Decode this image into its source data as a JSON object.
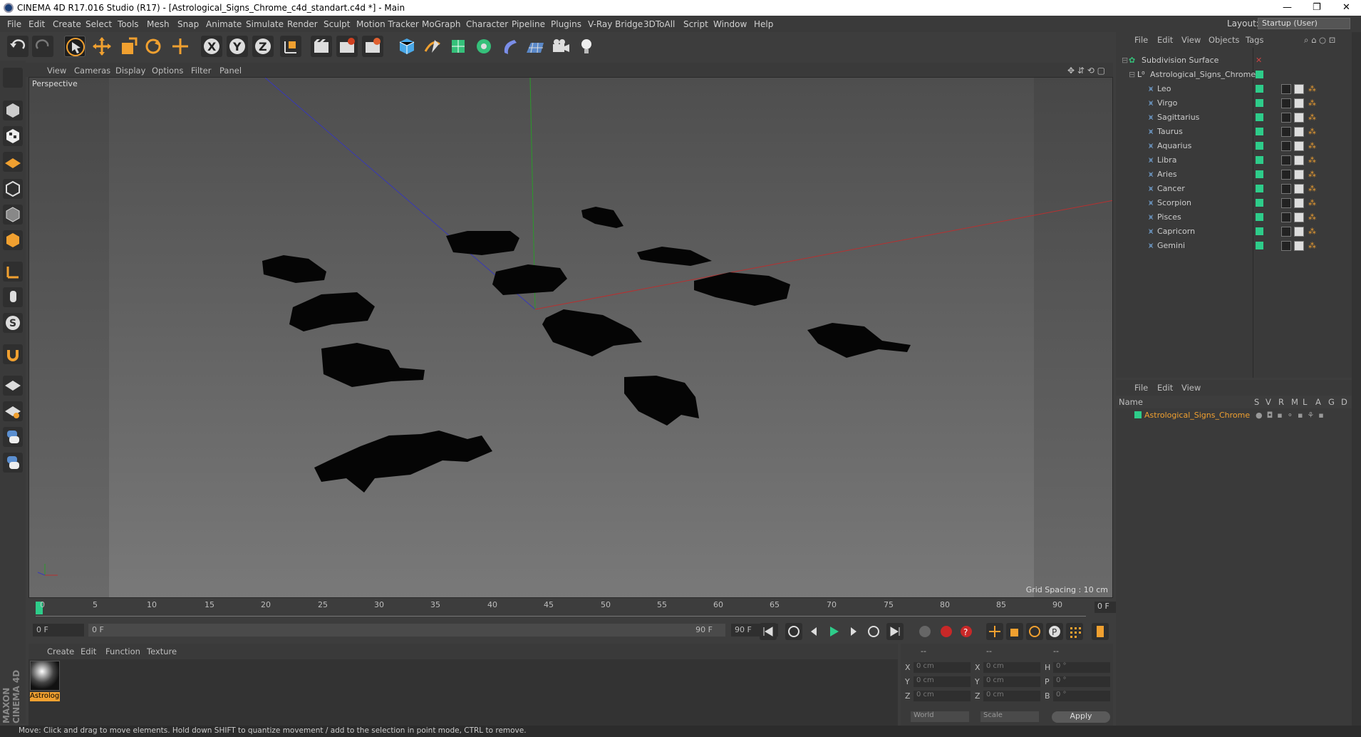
{
  "window": {
    "title": "CINEMA 4D R17.016 Studio (R17) - [Astrological_Signs_Chrome_c4d_standart.c4d *] - Main"
  },
  "menu": [
    "File",
    "Edit",
    "Create",
    "Select",
    "Tools",
    "Mesh",
    "Snap",
    "Animate",
    "Simulate",
    "Render",
    "Sculpt",
    "Motion Tracker",
    "MoGraph",
    "Character",
    "Pipeline",
    "Plugins",
    "V-Ray Bridge",
    "3DToAll",
    "Script",
    "Window",
    "Help"
  ],
  "layout": {
    "label": "Layout:",
    "value": "Startup (User)"
  },
  "viewport": {
    "menu": [
      "View",
      "Cameras",
      "Display",
      "Options",
      "Filter",
      "Panel"
    ],
    "camera_label": "Perspective",
    "grid_spacing": "Grid Spacing : 10 cm"
  },
  "timeline": {
    "ticks": [
      "0",
      "5",
      "10",
      "15",
      "20",
      "25",
      "30",
      "35",
      "40",
      "45",
      "50",
      "55",
      "60",
      "65",
      "70",
      "75",
      "80",
      "85",
      "90"
    ],
    "current": "0 F"
  },
  "transport": {
    "start": "0 F",
    "slider_left": "0 F",
    "slider_right": "90 F",
    "end": "90 F"
  },
  "material": {
    "menu": [
      "Create",
      "Edit",
      "Function",
      "Texture"
    ],
    "name": "Astrolog"
  },
  "coordinates": {
    "headers": [
      "--",
      "--",
      "--"
    ],
    "rows": [
      {
        "a": "X",
        "av": "0 cm",
        "b": "X",
        "bv": "0 cm",
        "c": "H",
        "cv": "0 °"
      },
      {
        "a": "Y",
        "av": "0 cm",
        "b": "Y",
        "bv": "0 cm",
        "c": "P",
        "cv": "0 °"
      },
      {
        "a": "Z",
        "av": "0 cm",
        "b": "Z",
        "bv": "0 cm",
        "c": "B",
        "cv": "0 °"
      }
    ],
    "mode1": "World",
    "mode2": "Scale",
    "apply": "Apply"
  },
  "object_manager": {
    "menu": [
      "File",
      "Edit",
      "View",
      "Objects",
      "Tags"
    ],
    "root": "Subdivision Surface",
    "group": "Astrological_Signs_Chrome",
    "items": [
      "Leo",
      "Virgo",
      "Sagittarius",
      "Taurus",
      "Aquarius",
      "Libra",
      "Aries",
      "Cancer",
      "Scorpion",
      "Pisces",
      "Capricorn",
      "Gemini"
    ]
  },
  "attributes": {
    "menu": [
      "File",
      "Edit",
      "View"
    ],
    "columns": [
      "Name",
      "S",
      "V",
      "R",
      "M",
      "L",
      "A",
      "G",
      "D"
    ],
    "layer": "Astrological_Signs_Chrome"
  },
  "status": "Move: Click and drag to move elements. Hold down SHIFT to quantize movement / add to the selection in point mode, CTRL to remove.",
  "branding": "MAXON CINEMA 4D",
  "colors": {
    "accent": "#f0a030",
    "green": "#2ecc8a",
    "axis_x": "#c03030",
    "axis_y": "#30a030",
    "axis_z": "#3030c0"
  }
}
